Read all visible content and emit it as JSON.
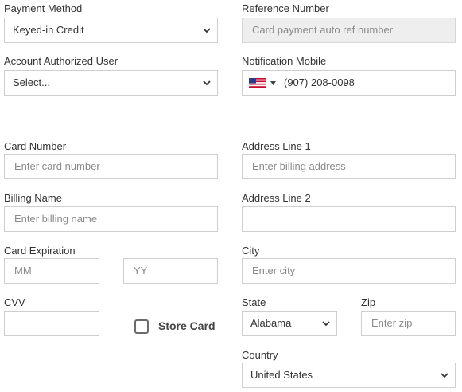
{
  "payment_method": {
    "label": "Payment Method",
    "value": "Keyed-in Credit"
  },
  "reference_number": {
    "label": "Reference Number",
    "placeholder": "Card payment auto ref number"
  },
  "authorized_user": {
    "label": "Account Authorized User",
    "value": "Select..."
  },
  "notification_mobile": {
    "label": "Notification Mobile",
    "country_flag": "us-flag-icon",
    "value": "(907) 208-0098"
  },
  "card_number": {
    "label": "Card Number",
    "placeholder": "Enter card number"
  },
  "billing_name": {
    "label": "Billing Name",
    "placeholder": "Enter billing name"
  },
  "card_expiration": {
    "label": "Card Expiration",
    "month_placeholder": "MM",
    "year_placeholder": "YY"
  },
  "cvv": {
    "label": "CVV",
    "value": ""
  },
  "store_card": {
    "label": "Store Card",
    "checked": false
  },
  "address_line_1": {
    "label": "Address Line 1",
    "placeholder": "Enter billing address"
  },
  "address_line_2": {
    "label": "Address Line 2",
    "value": ""
  },
  "city": {
    "label": "City",
    "placeholder": "Enter city"
  },
  "state": {
    "label": "State",
    "value": "Alabama"
  },
  "zip": {
    "label": "Zip",
    "placeholder": "Enter zip"
  },
  "country": {
    "label": "Country",
    "value": "United States"
  },
  "colors": {
    "border": "#cfcfcf",
    "disabled_bg": "#eeeeee",
    "label_text": "#333333",
    "placeholder_text": "#8a8a8a"
  }
}
